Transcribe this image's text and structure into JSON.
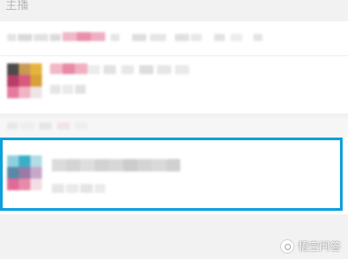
{
  "section": {
    "label": "主播"
  },
  "watermark": {
    "text": "悟空问答"
  },
  "colors": {
    "highlight": "#0ca0dc",
    "row_bg": "#ffffff",
    "page_bg": "#f2f2f2",
    "blur_gray": "#d9d9d9",
    "blur_pink": "#ef9fb5"
  }
}
